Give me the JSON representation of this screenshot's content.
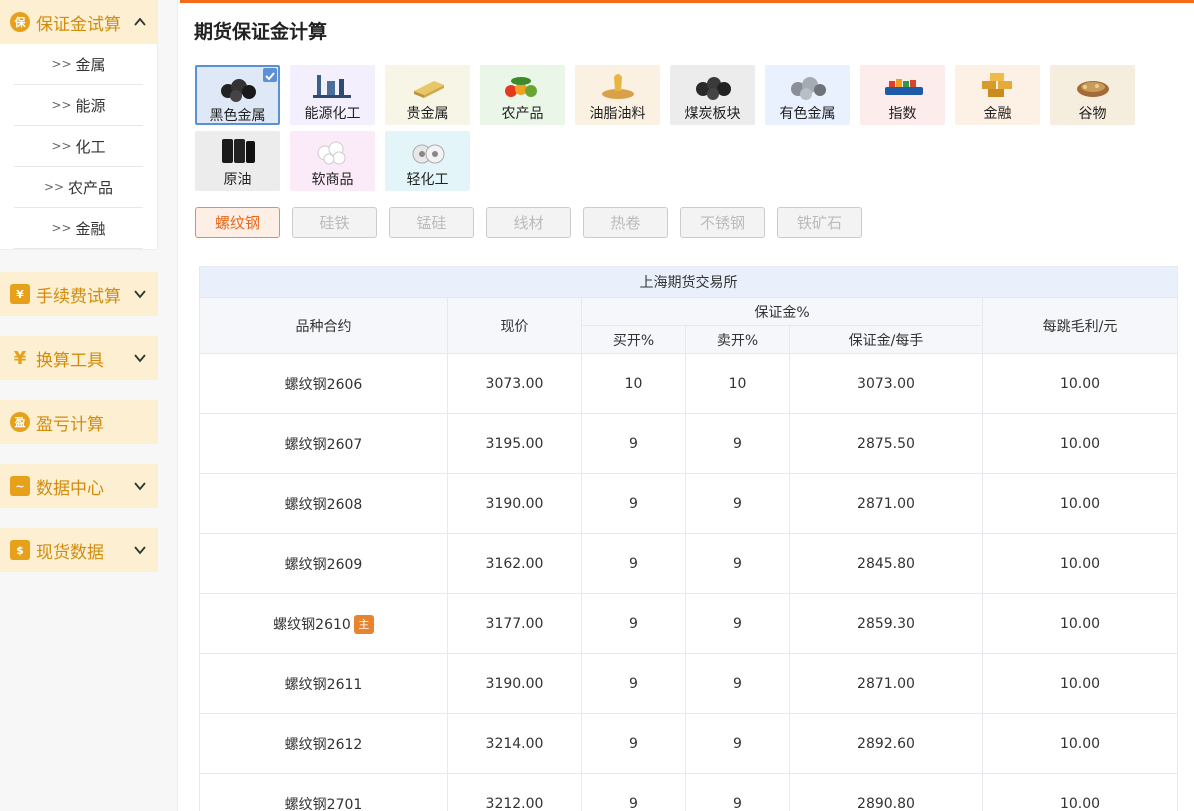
{
  "sidebar": {
    "groups": [
      {
        "label": "保证金试算",
        "icon": "保",
        "expanded": true,
        "items": [
          "金属",
          "能源",
          "化工",
          "农产品",
          "金融"
        ]
      },
      {
        "label": "手续费试算",
        "icon": "¥"
      },
      {
        "label": "换算工具",
        "icon": "¥"
      },
      {
        "label": "盈亏计算",
        "icon": "盈"
      },
      {
        "label": "数据中心",
        "icon": "~"
      },
      {
        "label": "现货数据",
        "icon": "$"
      }
    ]
  },
  "page": {
    "title": "期货保证金计算"
  },
  "categories": [
    {
      "label": "黑色金属",
      "bg": "#dfe8f6",
      "icon": "black-metal-icon",
      "selected": true
    },
    {
      "label": "能源化工",
      "bg": "#f3effc",
      "icon": "energy-chemical-icon"
    },
    {
      "label": "贵金属",
      "bg": "#f6f5e6",
      "icon": "precious-metal-icon"
    },
    {
      "label": "农产品",
      "bg": "#eaf6e8",
      "icon": "agriculture-icon"
    },
    {
      "label": "油脂油料",
      "bg": "#fbf1e2",
      "icon": "oil-icon"
    },
    {
      "label": "煤炭板块",
      "bg": "#ececec",
      "icon": "coal-icon"
    },
    {
      "label": "有色金属",
      "bg": "#e8f1fd",
      "icon": "nonferrous-icon"
    },
    {
      "label": "指数",
      "bg": "#fdecec",
      "icon": "index-icon"
    },
    {
      "label": "金融",
      "bg": "#fdf0e4",
      "icon": "finance-icon"
    },
    {
      "label": "谷物",
      "bg": "#f5eedf",
      "icon": "grain-icon"
    },
    {
      "label": "原油",
      "bg": "#ececec",
      "icon": "crude-oil-icon"
    },
    {
      "label": "软商品",
      "bg": "#fbeaf7",
      "icon": "soft-commodity-icon"
    },
    {
      "label": "轻化工",
      "bg": "#e3f5f8",
      "icon": "light-chemical-icon"
    }
  ],
  "tabs": [
    "螺纹钢",
    "硅铁",
    "锰硅",
    "线材",
    "热卷",
    "不锈钢",
    "铁矿石"
  ],
  "active_tab": 0,
  "table": {
    "exchange": "上海期货交易所",
    "col_contract": "品种合约",
    "col_price": "现价",
    "col_margin": "保证金%",
    "col_buy": "买开%",
    "col_sell": "卖开%",
    "col_per_lot": "保证金/每手",
    "col_tick": "每跳毛利/元",
    "main_badge": "主",
    "rows": [
      {
        "contract": "螺纹钢2606",
        "price": "3073.00",
        "buy": "10",
        "sell": "10",
        "per_lot": "3073.00",
        "tick": "10.00",
        "main": false
      },
      {
        "contract": "螺纹钢2607",
        "price": "3195.00",
        "buy": "9",
        "sell": "9",
        "per_lot": "2875.50",
        "tick": "10.00",
        "main": false
      },
      {
        "contract": "螺纹钢2608",
        "price": "3190.00",
        "buy": "9",
        "sell": "9",
        "per_lot": "2871.00",
        "tick": "10.00",
        "main": false
      },
      {
        "contract": "螺纹钢2609",
        "price": "3162.00",
        "buy": "9",
        "sell": "9",
        "per_lot": "2845.80",
        "tick": "10.00",
        "main": false
      },
      {
        "contract": "螺纹钢2610",
        "price": "3177.00",
        "buy": "9",
        "sell": "9",
        "per_lot": "2859.30",
        "tick": "10.00",
        "main": true
      },
      {
        "contract": "螺纹钢2611",
        "price": "3190.00",
        "buy": "9",
        "sell": "9",
        "per_lot": "2871.00",
        "tick": "10.00",
        "main": false
      },
      {
        "contract": "螺纹钢2612",
        "price": "3214.00",
        "buy": "9",
        "sell": "9",
        "per_lot": "2892.60",
        "tick": "10.00",
        "main": false
      },
      {
        "contract": "螺纹钢2701",
        "price": "3212.00",
        "buy": "9",
        "sell": "9",
        "per_lot": "2890.80",
        "tick": "10.00",
        "main": false
      }
    ]
  },
  "colors": {
    "accent": "#f56a18",
    "sidebar_text": "#d48b0c",
    "sidebar_bg": "#fdefd2",
    "selected_border": "#5b8fd6",
    "badge": "#e8842e"
  }
}
